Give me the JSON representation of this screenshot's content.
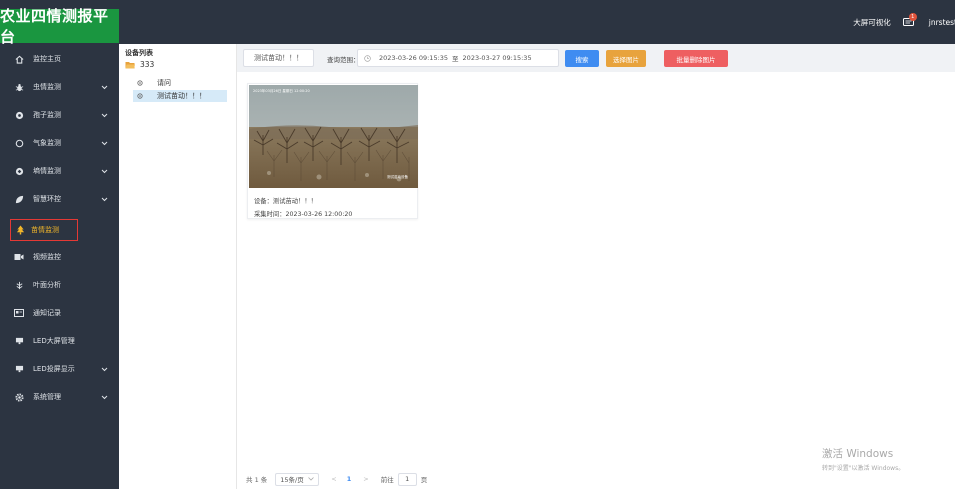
{
  "header": {
    "brand": "农业四情测报平台",
    "big_screen": "大屏可视化",
    "message_count": "1",
    "username": "jnrstest"
  },
  "sidebar": {
    "items": [
      {
        "label": "监控主页",
        "icon": "home-icon",
        "has_submenu": false
      },
      {
        "label": "虫情监测",
        "icon": "bug-icon",
        "has_submenu": true
      },
      {
        "label": "孢子监测",
        "icon": "spore-icon",
        "has_submenu": true
      },
      {
        "label": "气象监测",
        "icon": "weather-icon",
        "has_submenu": true
      },
      {
        "label": "墒情监测",
        "icon": "soil-icon",
        "has_submenu": true
      },
      {
        "label": "智慧环控",
        "icon": "leaf-icon",
        "has_submenu": true
      },
      {
        "label": "苗情监测",
        "icon": "tree-icon",
        "has_submenu": false,
        "active": true
      },
      {
        "label": "视频监控",
        "icon": "video-icon",
        "has_submenu": false
      },
      {
        "label": "叶面分析",
        "icon": "leaf-analysis-icon",
        "has_submenu": false
      },
      {
        "label": "通知记录",
        "icon": "notice-icon",
        "has_submenu": false
      },
      {
        "label": "LED大屏管理",
        "icon": "monitor-icon",
        "has_submenu": false
      },
      {
        "label": "LED投屏显示",
        "icon": "monitor-icon",
        "has_submenu": true
      },
      {
        "label": "系统管理",
        "icon": "settings-icon",
        "has_submenu": true
      }
    ]
  },
  "device_list": {
    "title": "设备列表",
    "group": "333",
    "nodes": [
      {
        "label": "请问",
        "selected": false
      },
      {
        "label": "测试苗动！！！",
        "selected": true
      }
    ]
  },
  "toolbar": {
    "device_button": "测试苗动！！！",
    "range_label": "查询范围：",
    "date_start": "2023-03-26 09:15:35",
    "date_separator": "至",
    "date_end": "2023-03-27 09:15:35",
    "search": "搜索",
    "select_images": "选择图片",
    "batch_delete": "批量删除图片"
  },
  "cards": [
    {
      "image_overlay_top": "2023年03月26日  星期日  12:00:20",
      "image_overlay_bottom": "测试苗动设备",
      "device_line": "设备：测试苗动！！！",
      "time_line": "采集时间：2023-03-26 12:00:20"
    }
  ],
  "pagination": {
    "total": "共 1 条",
    "page_size": "15条/页",
    "prev": "<",
    "current": "1",
    "next": ">",
    "goto_label": "前往",
    "goto_value": "1",
    "page_suffix": "页"
  },
  "watermark": {
    "title": "激活 Windows",
    "subtitle": "转到\"设置\"以激活 Windows。"
  },
  "colors": {
    "sidebar_bg": "#2c3441",
    "brand_bg": "#1a9640",
    "primary": "#3f8cf1",
    "warning": "#e8a33d",
    "danger": "#ee5f61",
    "active_text": "#f2b62a",
    "active_border": "#e53935",
    "selected_node_bg": "#d6eaf8"
  }
}
